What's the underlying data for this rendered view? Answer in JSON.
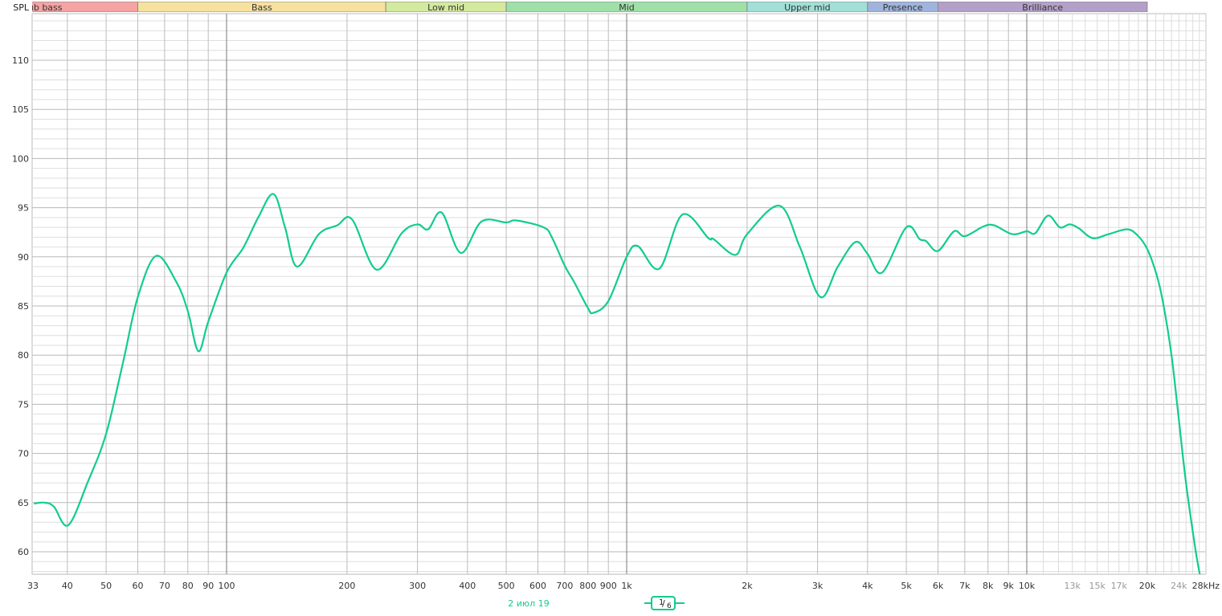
{
  "chart_data": {
    "type": "line",
    "ylabel": "SPL",
    "x_unit": "kHz",
    "x_scale": "log",
    "xlim": [
      33,
      28000
    ],
    "ylim": [
      57.7,
      114.7
    ],
    "grid": true,
    "x_ticks": [
      {
        "value": 33,
        "label": "33"
      },
      {
        "value": 40,
        "label": "40"
      },
      {
        "value": 50,
        "label": "50"
      },
      {
        "value": 60,
        "label": "60"
      },
      {
        "value": 70,
        "label": "70"
      },
      {
        "value": 80,
        "label": "80"
      },
      {
        "value": 90,
        "label": "90"
      },
      {
        "value": 100,
        "label": "100"
      },
      {
        "value": 200,
        "label": "200"
      },
      {
        "value": 300,
        "label": "300"
      },
      {
        "value": 400,
        "label": "400"
      },
      {
        "value": 500,
        "label": "500"
      },
      {
        "value": 600,
        "label": "600"
      },
      {
        "value": 700,
        "label": "700"
      },
      {
        "value": 800,
        "label": "800"
      },
      {
        "value": 900,
        "label": "900"
      },
      {
        "value": 1000,
        "label": "1k"
      },
      {
        "value": 2000,
        "label": "2k"
      },
      {
        "value": 3000,
        "label": "3k"
      },
      {
        "value": 4000,
        "label": "4k"
      },
      {
        "value": 5000,
        "label": "5k"
      },
      {
        "value": 6000,
        "label": "6k"
      },
      {
        "value": 7000,
        "label": "7k"
      },
      {
        "value": 8000,
        "label": "8k"
      },
      {
        "value": 9000,
        "label": "9k"
      },
      {
        "value": 10000,
        "label": "10k"
      },
      {
        "value": 13000,
        "label": "13k",
        "muted": true
      },
      {
        "value": 15000,
        "label": "15k",
        "muted": true
      },
      {
        "value": 17000,
        "label": "17k",
        "muted": true
      },
      {
        "value": 20000,
        "label": "20k"
      },
      {
        "value": 24000,
        "label": "24k",
        "muted": true
      },
      {
        "value": 28000,
        "label": "28kHz"
      }
    ],
    "y_ticks": [
      60,
      65,
      70,
      75,
      80,
      85,
      90,
      95,
      100,
      105,
      110
    ],
    "bands": [
      {
        "label": "Sub bass",
        "from": 20,
        "to": 60,
        "color": "#f5a3a3"
      },
      {
        "label": "Bass",
        "from": 60,
        "to": 250,
        "color": "#f7e19f"
      },
      {
        "label": "Low mid",
        "from": 250,
        "to": 500,
        "color": "#d3e99d"
      },
      {
        "label": "Mid",
        "from": 500,
        "to": 2000,
        "color": "#9fe0a9"
      },
      {
        "label": "Upper mid",
        "from": 2000,
        "to": 4000,
        "color": "#a0e0d6"
      },
      {
        "label": "Presence",
        "from": 4000,
        "to": 6000,
        "color": "#9fb4dd"
      },
      {
        "label": "Brilliance",
        "from": 6000,
        "to": 20000,
        "color": "#b3a0c9"
      }
    ],
    "series": [
      {
        "color": "#11cc91",
        "x": [
          33,
          35,
          37,
          40.2,
          45,
          50,
          55,
          60,
          66.7,
          75,
          80,
          85,
          90,
          100,
          110,
          120,
          131,
          140,
          150,
          170,
          189,
          206,
          237,
          274,
          300,
          319,
          345,
          385,
          434,
          500,
          530,
          620,
          650,
          700,
          740,
          800,
          825,
          900,
          1000,
          1066,
          1207,
          1378,
          1600,
          1650,
          1870,
          2000,
          2410,
          2710,
          3050,
          3370,
          3730,
          4000,
          4350,
          5000,
          5400,
          5600,
          6000,
          6580,
          7000,
          7800,
          8300,
          9200,
          10000,
          10500,
          11300,
          12100,
          12800,
          13500,
          14600,
          16000,
          17800,
          18900,
          20000,
          21100,
          21900,
          23000,
          23900,
          25000,
          26400,
          27100
        ],
        "y": [
          64.9,
          65.0,
          64.6,
          62.7,
          67.1,
          72.0,
          79.1,
          85.9,
          90.1,
          87.4,
          84.5,
          80.4,
          83.4,
          88.4,
          90.9,
          94.0,
          96.4,
          93.0,
          89.0,
          92.3,
          93.2,
          93.8,
          88.7,
          92.4,
          93.3,
          92.8,
          94.5,
          90.4,
          93.6,
          93.5,
          93.7,
          93.0,
          92.0,
          89.1,
          87.4,
          84.8,
          84.3,
          85.5,
          90.0,
          91.1,
          88.8,
          94.3,
          91.9,
          91.8,
          90.2,
          92.3,
          95.2,
          91.0,
          85.9,
          89.0,
          91.5,
          90.3,
          88.4,
          93.0,
          91.8,
          91.6,
          90.6,
          92.6,
          92.1,
          93.1,
          93.2,
          92.3,
          92.6,
          92.4,
          94.2,
          93.0,
          93.3,
          92.9,
          91.9,
          92.3,
          92.8,
          92.2,
          90.8,
          88.2,
          85.4,
          80.0,
          74.1,
          67.0,
          60.2,
          57.6
        ]
      }
    ]
  },
  "footer": {
    "date_label": "2 июл 19",
    "date_color": "#11cc91",
    "smoothing_num": "1",
    "smoothing_den": "6"
  }
}
